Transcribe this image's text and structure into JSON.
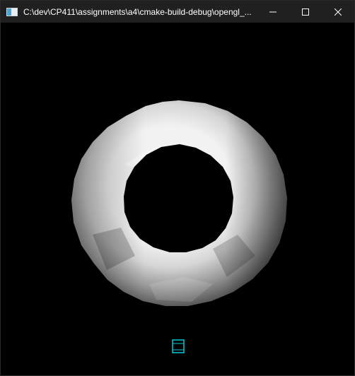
{
  "window": {
    "title": "C:\\dev\\CP411\\assignments\\a4\\cmake-build-debug\\opengl_...",
    "controls": {
      "minimize_icon": "minimize-icon",
      "maximize_icon": "maximize-icon",
      "close_icon": "close-icon"
    }
  },
  "scene": {
    "object": "torus",
    "background_color": "#000000",
    "indicator_color": "#00c8d8"
  }
}
